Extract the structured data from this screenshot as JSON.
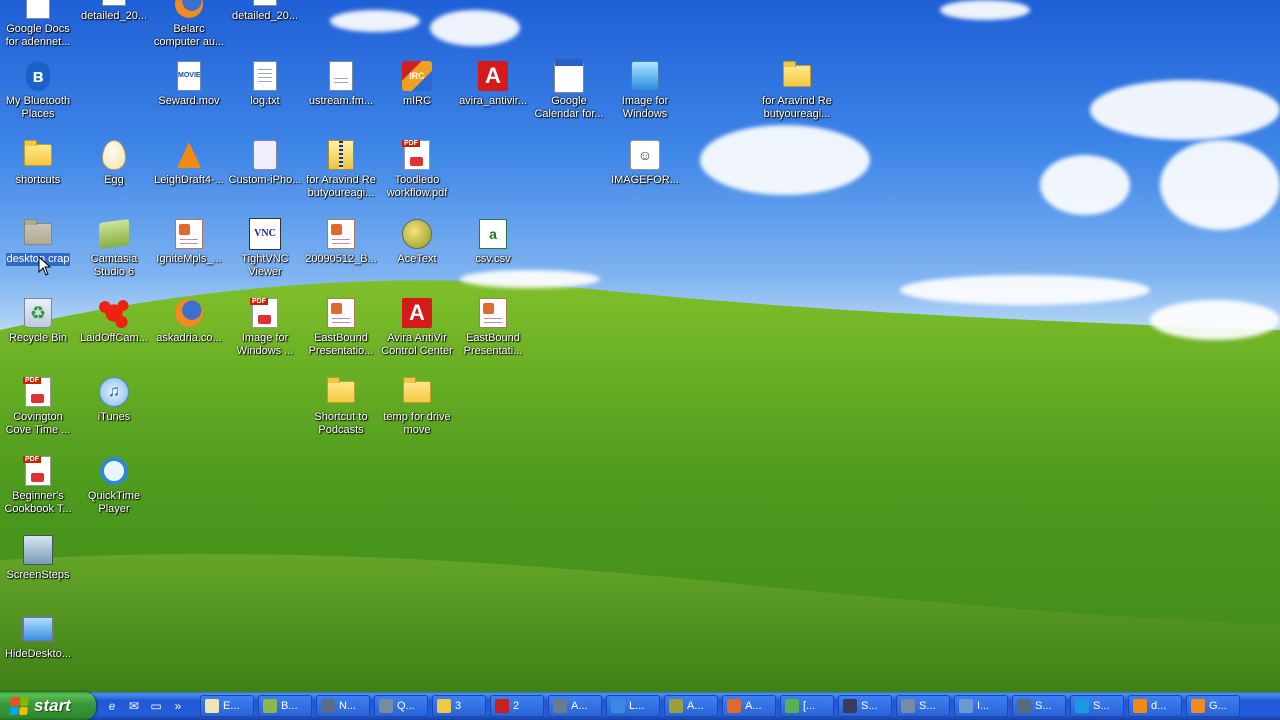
{
  "desktop": {
    "icons": [
      {
        "id": "google-docs",
        "label": "Google Docs\nfor adennet...",
        "icon": "google-docs-icon"
      },
      {
        "id": "detailed-1",
        "label": "detailed_20...",
        "icon": "document-icon"
      },
      {
        "id": "belarc",
        "label": "Belarc\ncomputer au...",
        "icon": "firefox-document-icon"
      },
      {
        "id": "detailed-2",
        "label": "detailed_20...",
        "icon": "document-icon"
      },
      {
        "id": "bluetooth",
        "label": "My Bluetooth\nPlaces",
        "icon": "bluetooth-icon"
      },
      {
        "id": "seward",
        "label": "Seward.mov",
        "icon": "movie-file-icon"
      },
      {
        "id": "log",
        "label": "log.txt",
        "icon": "text-file-icon"
      },
      {
        "id": "ustream",
        "label": "ustream.fm...",
        "icon": "web-document-icon"
      },
      {
        "id": "mirc",
        "label": "mIRC",
        "icon": "mirc-icon"
      },
      {
        "id": "avira-antivir",
        "label": "avira_antivir...",
        "icon": "avira-icon"
      },
      {
        "id": "google-calendar",
        "label": "Google\nCalendar for...",
        "icon": "calendar-icon"
      },
      {
        "id": "image-for-windows-1",
        "label": "Image for\nWindows",
        "icon": "image-for-windows-icon"
      },
      {
        "id": "for-aravind-1",
        "label": "for Aravind Re\nbutyoureagi...",
        "icon": "folder-icon"
      },
      {
        "id": "shortcuts",
        "label": "shortcuts",
        "icon": "folder-icon"
      },
      {
        "id": "egg",
        "label": "Egg",
        "icon": "egg-icon"
      },
      {
        "id": "leighdraft",
        "label": "LeighDraft4-...",
        "icon": "vlc-cone-icon"
      },
      {
        "id": "custom-iphone",
        "label": "Custom-iPho...",
        "icon": "ipod-file-icon"
      },
      {
        "id": "for-aravind-2",
        "label": "for Aravind Re\nbutyoureagi...",
        "icon": "zip-folder-icon"
      },
      {
        "id": "toodledo",
        "label": "Toodledo\nworkflow.pdf",
        "icon": "pdf-icon"
      },
      {
        "id": "imagefor",
        "label": "IMAGEFOR...",
        "icon": "imagefor-icon"
      },
      {
        "id": "desktop-crap",
        "label": "desktop crap",
        "icon": "folder-icon"
      },
      {
        "id": "camtasia",
        "label": "Camtasia\nStudio 6",
        "icon": "camtasia-icon"
      },
      {
        "id": "ignitempls",
        "label": "IgniteMpls_...",
        "icon": "powerpoint-icon"
      },
      {
        "id": "tightvnc",
        "label": "TightVNC\nViewer",
        "icon": "vnc-icon"
      },
      {
        "id": "20090512",
        "label": "20090512_B...",
        "icon": "powerpoint-icon"
      },
      {
        "id": "acetext",
        "label": "AceText",
        "icon": "acetext-icon"
      },
      {
        "id": "csv",
        "label": "csv.csv",
        "icon": "csv-icon"
      },
      {
        "id": "recycle-bin",
        "label": "Recycle Bin",
        "icon": "recycle-bin-icon"
      },
      {
        "id": "laidoffcam",
        "label": "LaidOffCam...",
        "icon": "splat-icon"
      },
      {
        "id": "askadria",
        "label": "askadria.co...",
        "icon": "firefox-icon"
      },
      {
        "id": "image-for-windows-2",
        "label": "Image for\nWindows ...",
        "icon": "pdf-icon"
      },
      {
        "id": "eastbound-1",
        "label": "EastBound\nPresentatio...",
        "icon": "powerpoint-icon"
      },
      {
        "id": "avira-control",
        "label": "Avira AntiVir\nControl Center",
        "icon": "avira-icon"
      },
      {
        "id": "eastbound-2",
        "label": "EastBound\nPresentati...",
        "icon": "powerpoint-icon"
      },
      {
        "id": "covington",
        "label": "Covington\nCove Time ...",
        "icon": "pdf-icon"
      },
      {
        "id": "itunes",
        "label": "iTunes",
        "icon": "itunes-icon"
      },
      {
        "id": "shortcut-podcasts",
        "label": "Shortcut to\nPodcasts",
        "icon": "folder-icon"
      },
      {
        "id": "temp-drive",
        "label": "temp for drive\nmove",
        "icon": "folder-icon"
      },
      {
        "id": "beginners",
        "label": "Beginner's\nCookbook T...",
        "icon": "pdf-icon"
      },
      {
        "id": "quicktime",
        "label": "QuickTime\nPlayer",
        "icon": "quicktime-icon"
      },
      {
        "id": "screensteps",
        "label": "ScreenSteps",
        "icon": "screensteps-icon"
      },
      {
        "id": "hidedesktop",
        "label": "HideDeskto...",
        "icon": "monitor-icon"
      }
    ]
  },
  "taskbar": {
    "start_label": "start",
    "quicklaunch": [
      {
        "icon": "ie-icon",
        "glyph": "e"
      },
      {
        "icon": "outlook-icon",
        "glyph": "✉"
      },
      {
        "icon": "show-desktop-icon",
        "glyph": "▭"
      },
      {
        "icon": "overflow-chevron-icon",
        "glyph": "»"
      }
    ],
    "tasks": [
      {
        "label": "E...",
        "icon": "egg-icon",
        "color": "#f2e6b0"
      },
      {
        "label": "B...",
        "icon": "camtasia-icon",
        "color": "#8ab84a"
      },
      {
        "label": "N...",
        "icon": "lock-icon",
        "color": "#5a6a8a"
      },
      {
        "label": "Q...",
        "icon": "search-icon",
        "color": "#7a8aa0"
      },
      {
        "label": "3",
        "icon": "folder-icon",
        "color": "#f0c848"
      },
      {
        "label": "2",
        "icon": "filezilla-icon",
        "color": "#c82020"
      },
      {
        "label": "A...",
        "icon": "app-icon",
        "color": "#6a7a90"
      },
      {
        "label": "L...",
        "icon": "ie-icon",
        "color": "#3a8ae0"
      },
      {
        "label": "A...",
        "icon": "acetext-icon",
        "color": "#9aa040"
      },
      {
        "label": "A...",
        "icon": "splat-icon",
        "color": "#e06a2c"
      },
      {
        "label": "[...",
        "icon": "notepad-icon",
        "color": "#5ab050"
      },
      {
        "label": "S...",
        "icon": "screensteps-icon",
        "color": "#3a3a60"
      },
      {
        "label": "S...",
        "icon": "window-icon",
        "color": "#7a8aa0"
      },
      {
        "label": "I...",
        "icon": "image-icon",
        "color": "#6a9ad0"
      },
      {
        "label": "S...",
        "icon": "settings-icon",
        "color": "#5a6a80"
      },
      {
        "label": "S...",
        "icon": "skype-icon",
        "color": "#1a9ae0"
      },
      {
        "label": "d...",
        "icon": "vlc-cone-icon",
        "color": "#f08a13"
      },
      {
        "label": "G...",
        "icon": "firefox-icon",
        "color": "#f28a1d"
      }
    ]
  }
}
